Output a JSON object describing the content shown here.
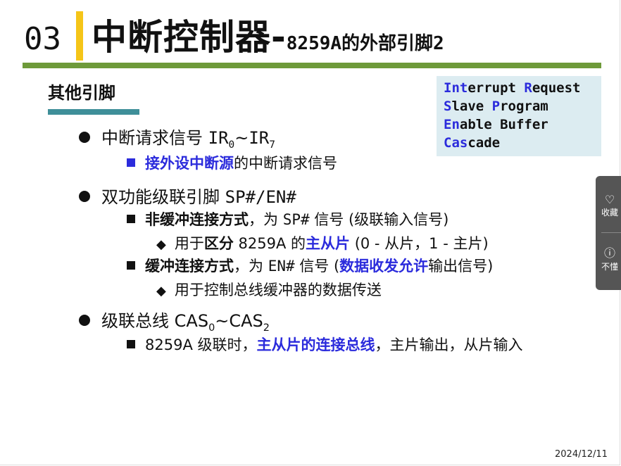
{
  "slide": {
    "number": "03",
    "title_main": "中断控制器",
    "title_dash": "-",
    "title_sub": "8259A的外部引脚2",
    "subtitle": "其他引脚",
    "date": "2024/12/11"
  },
  "box": {
    "l1a": "Int",
    "l1b": "errupt ",
    "l1c": "R",
    "l1d": "equest",
    "l2a": "S",
    "l2b": "lave ",
    "l2c": "P",
    "l2d": "rogram",
    "l3a": "En",
    "l3b": "able Buffer",
    "l4a": "Cas",
    "l4b": "cade"
  },
  "content": {
    "ir_label": "中断请求信号 ",
    "ir_a": "IR",
    "ir_a_sub": "0",
    "ir_tilde": "~",
    "ir_b": "IR",
    "ir_b_sub": "7",
    "ir_detail_blue": "接外设中断源",
    "ir_detail_rest": "的中断请求信号",
    "spen_label": "双功能级联引脚 ",
    "spen_code": "SP#/EN#",
    "nb_bold": "非缓冲连接方式",
    "nb_mid": "，为 ",
    "nb_code": "SP#",
    "nb_rest": " 信号 (级联输入信号)",
    "nb_sub_a": "用于",
    "nb_sub_bold": "区分",
    "nb_sub_b": " 8259A 的",
    "nb_sub_blue": "主从片",
    "nb_sub_c": " (0 - 从片，1 - 主片)",
    "b_bold": "缓冲连接方式",
    "b_mid": "，为 ",
    "b_code": "EN#",
    "b_rest1": " 信号 (",
    "b_blue": "数据收发允许",
    "b_rest2": "输出信号)",
    "b_sub": "用于控制总线缓冲器的数据传送",
    "cas_label": "级联总线 ",
    "cas_a": "CAS",
    "cas_a_sub": "0",
    "cas_tilde": "~",
    "cas_b": "CAS",
    "cas_b_sub": "2",
    "cas_detail_a": "8259A 级联时，",
    "cas_detail_blue": "主从片的连接总线",
    "cas_detail_b": "，主片输出，从片输入"
  },
  "sidebar": {
    "fav_icon": "heart-icon",
    "fav_label": "收藏",
    "help_icon": "question-icon",
    "help_label": "不懂"
  }
}
